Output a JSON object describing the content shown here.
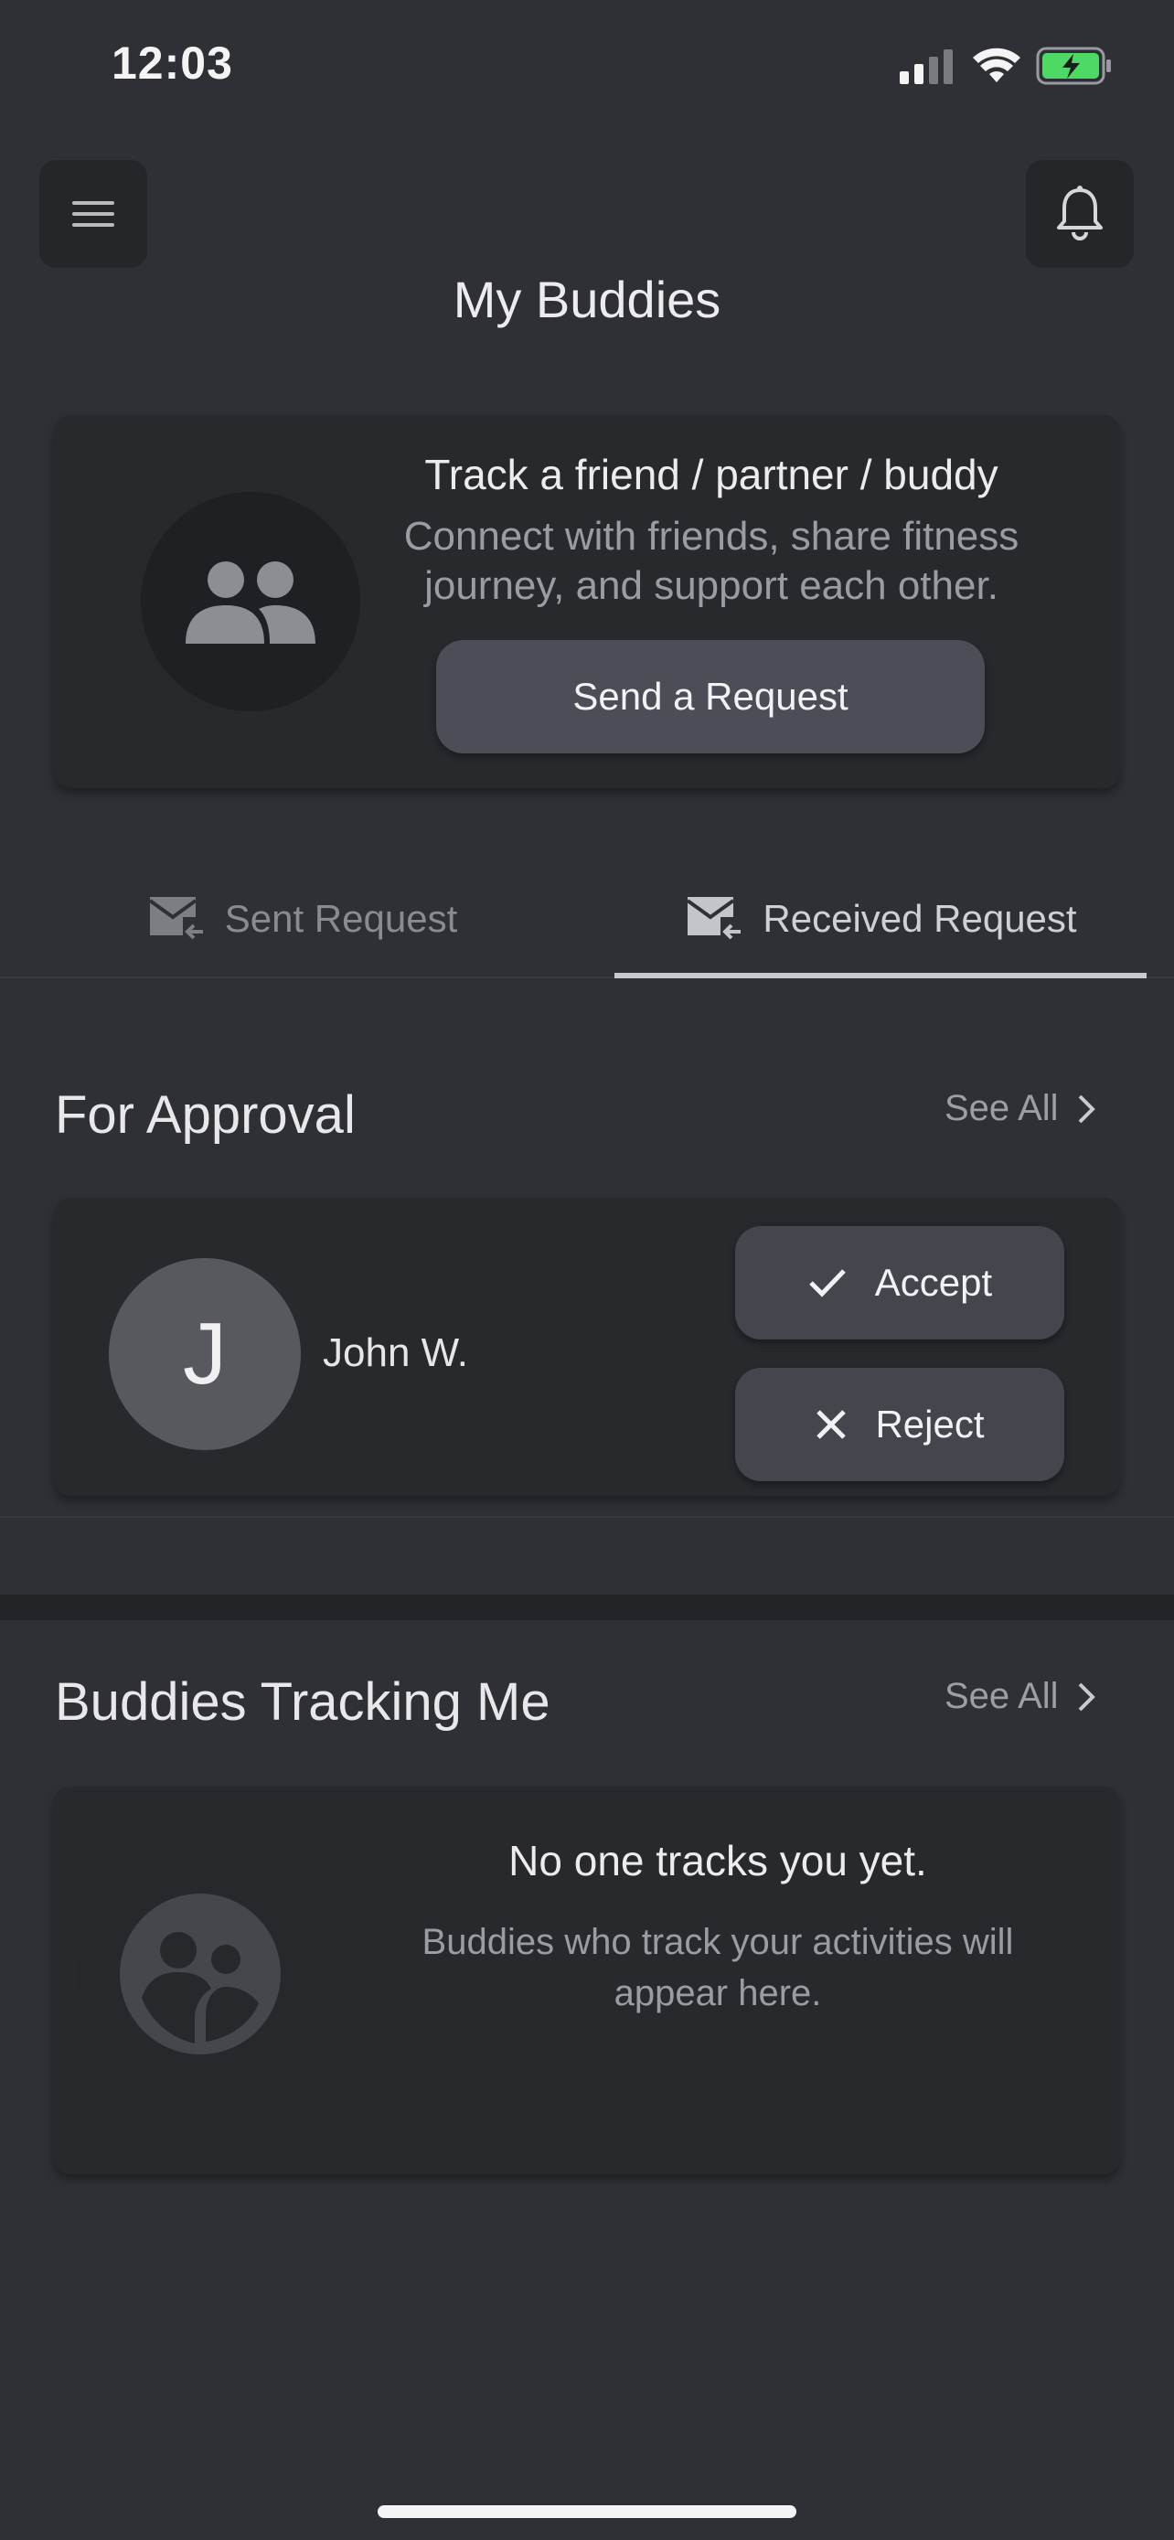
{
  "status_bar": {
    "time": "12:03"
  },
  "header": {
    "title": "My Buddies"
  },
  "intro": {
    "title": "Track a friend / partner / buddy",
    "description_line1": "Connect with friends, share fitness",
    "description_line2": "journey, and support each other.",
    "button_label": "Send a Request"
  },
  "tabs": [
    {
      "label": "Sent Request",
      "selected": false
    },
    {
      "label": "Received Request",
      "selected": true
    }
  ],
  "approval": {
    "title": "For Approval",
    "see_all": "See All",
    "request": {
      "initial": "J",
      "name": "John W.",
      "accept_label": "Accept",
      "reject_label": "Reject"
    }
  },
  "tracking": {
    "title": "Buddies Tracking Me",
    "see_all": "See All",
    "empty_title": "No one tracks you yet.",
    "empty_desc_line1": "Buddies who track your activities will",
    "empty_desc_line2": "appear here."
  },
  "colors": {
    "background": "#2f3035",
    "card": "#28292d",
    "button": "#4b4e56",
    "battery": "#4cd964"
  },
  "icons": [
    "menu-icon",
    "bell-icon",
    "people-icon",
    "mail-icon",
    "check-icon",
    "close-icon",
    "chevron-right-icon",
    "group-icon"
  ]
}
